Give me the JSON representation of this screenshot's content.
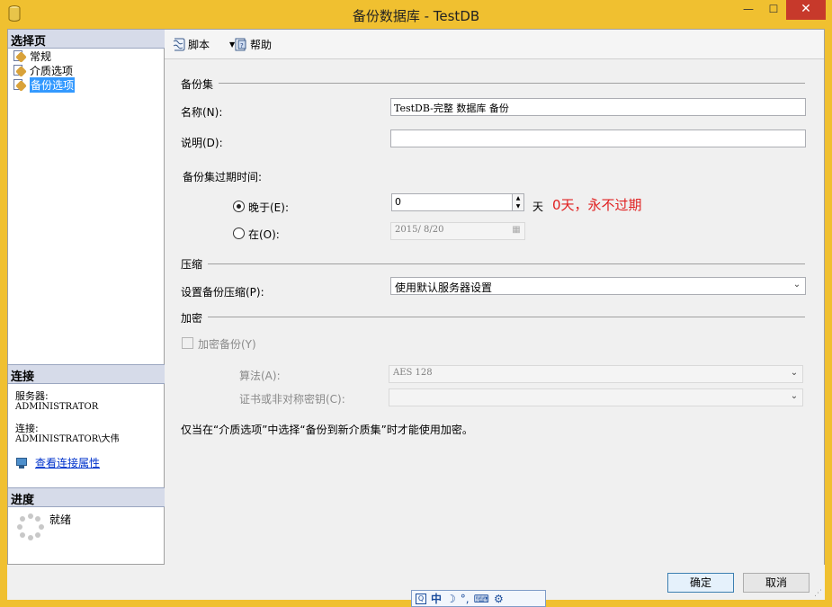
{
  "window": {
    "title": "备份数据库 - TestDB",
    "minimize_glyph": "—",
    "maximize_glyph": "☐",
    "close_glyph": "✕"
  },
  "sidebar": {
    "select_page_header": "选择页",
    "pages": [
      {
        "label": "常规",
        "selected": false
      },
      {
        "label": "介质选项",
        "selected": false
      },
      {
        "label": "备份选项",
        "selected": true
      }
    ],
    "connection_header": "连接",
    "server_label": "服务器:",
    "server_value": "ADMINISTRATOR",
    "connection_label": "连接:",
    "connection_value": "ADMINISTRATOR\\大伟",
    "view_connection_link": "查看连接属性",
    "progress_header": "进度",
    "progress_status": "就绪"
  },
  "toolbar": {
    "script_label": "脚本",
    "help_label": "帮助"
  },
  "backup_set": {
    "group_title": "备份集",
    "name_label": "名称(N):",
    "name_value": "TestDB-完整 数据库 备份",
    "description_label": "说明(D):",
    "description_value": "",
    "expire_label": "备份集过期时间:",
    "after_label": "晚于(E):",
    "after_value": "0",
    "after_unit": "天",
    "after_selected": true,
    "on_label": "在(O):",
    "on_value": "2015/ 8/20",
    "note": "0天，永不过期"
  },
  "compression": {
    "group_title": "压缩",
    "setting_label": "设置备份压缩(P):",
    "setting_value": "使用默认服务器设置"
  },
  "encryption": {
    "group_title": "加密",
    "encrypt_label": "加密备份(Y)",
    "algorithm_label": "算法(A):",
    "algorithm_value": "AES 128",
    "cert_label": "证书或非对称密钥(C):",
    "cert_value": "",
    "info_text": "仅当在“介质选项”中选择“备份到新介质集”时才能使用加密。"
  },
  "footer": {
    "ok_label": "确定",
    "cancel_label": "取消"
  },
  "ime_bar": {
    "mode": "中",
    "items": [
      "☽",
      "°,",
      "⌨",
      "⚙"
    ]
  },
  "colors": {
    "title_bar": "#f0c030",
    "close_button": "#c7392b",
    "section_header": "#d6dbe9",
    "selection": "#3399ff",
    "note_red": "#e02020",
    "link_blue": "#0033cc"
  }
}
